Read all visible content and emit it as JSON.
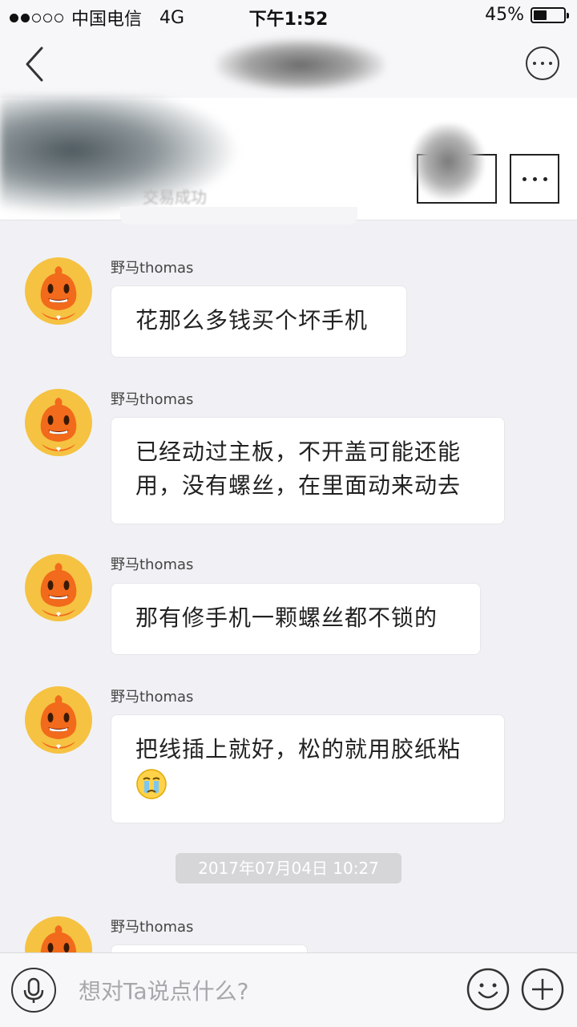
{
  "status_bar": {
    "carrier": "中国电信",
    "network": "4G",
    "time": "下午1:52",
    "battery": "45%",
    "battery_level": 0.45,
    "signal_filled": 2,
    "signal_total": 5
  },
  "nav": {
    "back_icon": "chevron-left-icon",
    "more_icon": "more-dots-icon"
  },
  "item_card": {
    "status": "交易成功"
  },
  "messages": [
    {
      "sender": "野马thomas",
      "text": "花那么多钱买个坏手机"
    },
    {
      "sender": "野马thomas",
      "text": "已经动过主板，不开盖可能还能用，没有螺丝，在里面动来动去"
    },
    {
      "sender": "野马thomas",
      "text": "那有修手机一颗螺丝都不锁的"
    },
    {
      "sender": "野马thomas",
      "text": "把线插上就好，松的就用胶纸粘",
      "emoji": "crying-face-icon"
    },
    {
      "sender": "野马thomas",
      "text": ""
    }
  ],
  "timestamp": "2017年07月04日 10:27",
  "input_bar": {
    "placeholder": "想对Ta说点什么?",
    "voice_icon": "microphone-icon",
    "emoji_icon": "smiley-icon",
    "add_icon": "plus-icon"
  },
  "colors": {
    "background": "#f1f1f5",
    "bubble": "#ffffff",
    "avatar_ring": "#f5c242",
    "avatar_body": "#f26a1b"
  }
}
